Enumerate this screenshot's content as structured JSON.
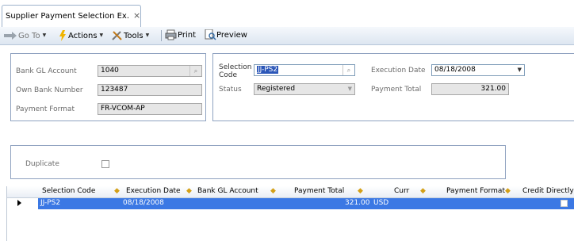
{
  "tab": {
    "title": "Supplier Payment Selection Ex.",
    "close_glyph": "×"
  },
  "toolbar": {
    "goto_label": "Go To",
    "actions_label": "Actions",
    "tools_label": "Tools",
    "print_label": "Print",
    "preview_label": "Preview"
  },
  "bank_panel": {
    "bank_gl_account": {
      "label": "Bank GL Account",
      "value": "1040"
    },
    "own_bank_number": {
      "label": "Own Bank Number",
      "value": "123487"
    },
    "payment_format": {
      "label": "Payment Format",
      "value": "FR-VCOM-AP"
    }
  },
  "selection_panel": {
    "selection_code": {
      "label_line1": "Selection",
      "label_line2": "Code",
      "value": "JJ-PS2"
    },
    "status": {
      "label": "Status",
      "value": "Registered"
    },
    "execution_date": {
      "label": "Execution Date",
      "value": "08/18/2008"
    },
    "payment_total": {
      "label": "Payment Total",
      "value": "321.00"
    }
  },
  "duplicate": {
    "label": "Duplicate",
    "checked": false
  },
  "grid": {
    "columns": [
      "Selection Code",
      "Execution Date",
      "Bank GL Account",
      "Payment Total",
      "Curr",
      "Payment Format",
      "Credit Directly o"
    ],
    "rows": [
      {
        "selection_code": "JJ-PS2",
        "execution_date": "08/18/2008",
        "bank_gl_account": "",
        "payment_total": "321.00",
        "curr": "USD",
        "payment_format": "",
        "credit_directly": false
      }
    ]
  },
  "colors": {
    "selection_row": "#3b78e4",
    "panel_border": "#8fa2c0",
    "toolbar_top": "#f5f8fc",
    "toolbar_bottom": "#dde6f1"
  },
  "icons": [
    "goto-icon",
    "actions-icon",
    "tools-icon",
    "print-icon",
    "preview-icon",
    "search-icon",
    "dropdown-arrow-icon",
    "row-indicator-icon"
  ]
}
